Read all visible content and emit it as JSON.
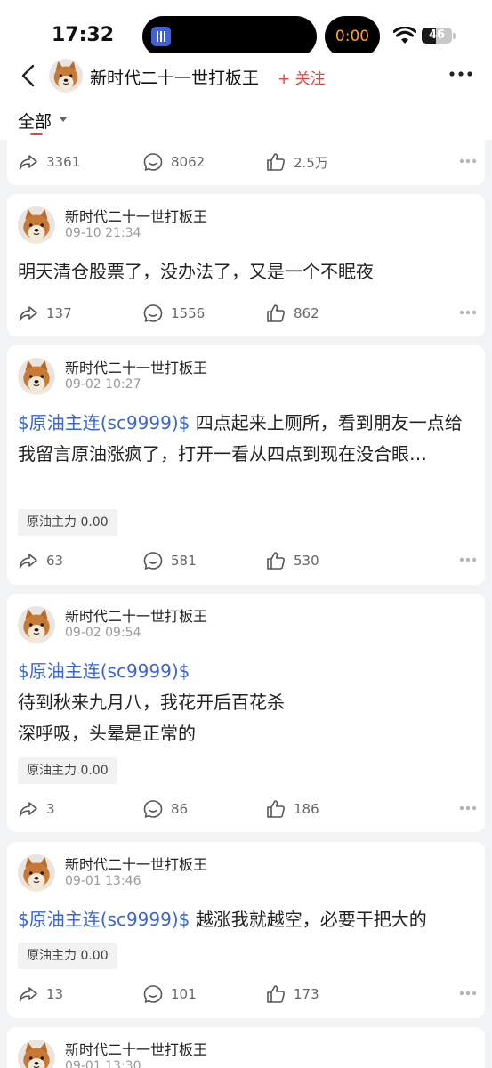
{
  "status_bar": {
    "time": "17:32",
    "recording_timer": "0:00",
    "battery_level": "46",
    "battery_fraction": 0.46
  },
  "nav": {
    "back_icon": "chevron-left-icon",
    "author_name": "新时代二十一世打板王",
    "follow_label": "+ 关注",
    "more_icon": "more-horizontal-icon"
  },
  "filter": {
    "label": "全部",
    "accent_color": "#e8433e"
  },
  "colors": {
    "stock_link": "#3a66d3",
    "follow": "#e8433e"
  },
  "top_card": {
    "shares": "3361",
    "comments": "8062",
    "likes": "2.5万"
  },
  "posts": [
    {
      "author": "新时代二十一世打板王",
      "time": "09-10 21:34",
      "stock": "",
      "text": "明天清仓股票了，没办法了，又是一个不眠夜",
      "tag": "",
      "shares": "137",
      "comments": "1556",
      "likes": "862"
    },
    {
      "author": "新时代二十一世打板王",
      "time": "09-02 10:27",
      "stock": "$原油主连(sc9999)$",
      "text": " 四点起来上厕所，看到朋友一点给我留言原油涨疯了，打开一看从四点到现在没合眼…",
      "tag": "原油主力  0.00",
      "shares": "63",
      "comments": "581",
      "likes": "530"
    },
    {
      "author": "新时代二十一世打板王",
      "time": "09-02 09:54",
      "stock": "$原油主连(sc9999)$",
      "text": "待到秋来九月八，我花开后百花杀\n深呼吸，头晕是正常的",
      "tag": "原油主力  0.00",
      "shares": "3",
      "comments": "86",
      "likes": "186"
    },
    {
      "author": "新时代二十一世打板王",
      "time": "09-01 13:46",
      "stock": "$原油主连(sc9999)$",
      "text": " 越涨我就越空，必要干把大的",
      "tag": "原油主力  0.00",
      "shares": "13",
      "comments": "101",
      "likes": "173"
    },
    {
      "author": "新时代二十一世打板王",
      "time": "09-01 13:30",
      "stock": "",
      "text": "",
      "tag": "",
      "shares": "",
      "comments": "",
      "likes": ""
    }
  ],
  "icons": {
    "share": "share-icon",
    "comment": "comment-icon",
    "like": "thumbs-up-icon",
    "more": "more-dots-icon",
    "avatar": "shiba-avatar"
  }
}
